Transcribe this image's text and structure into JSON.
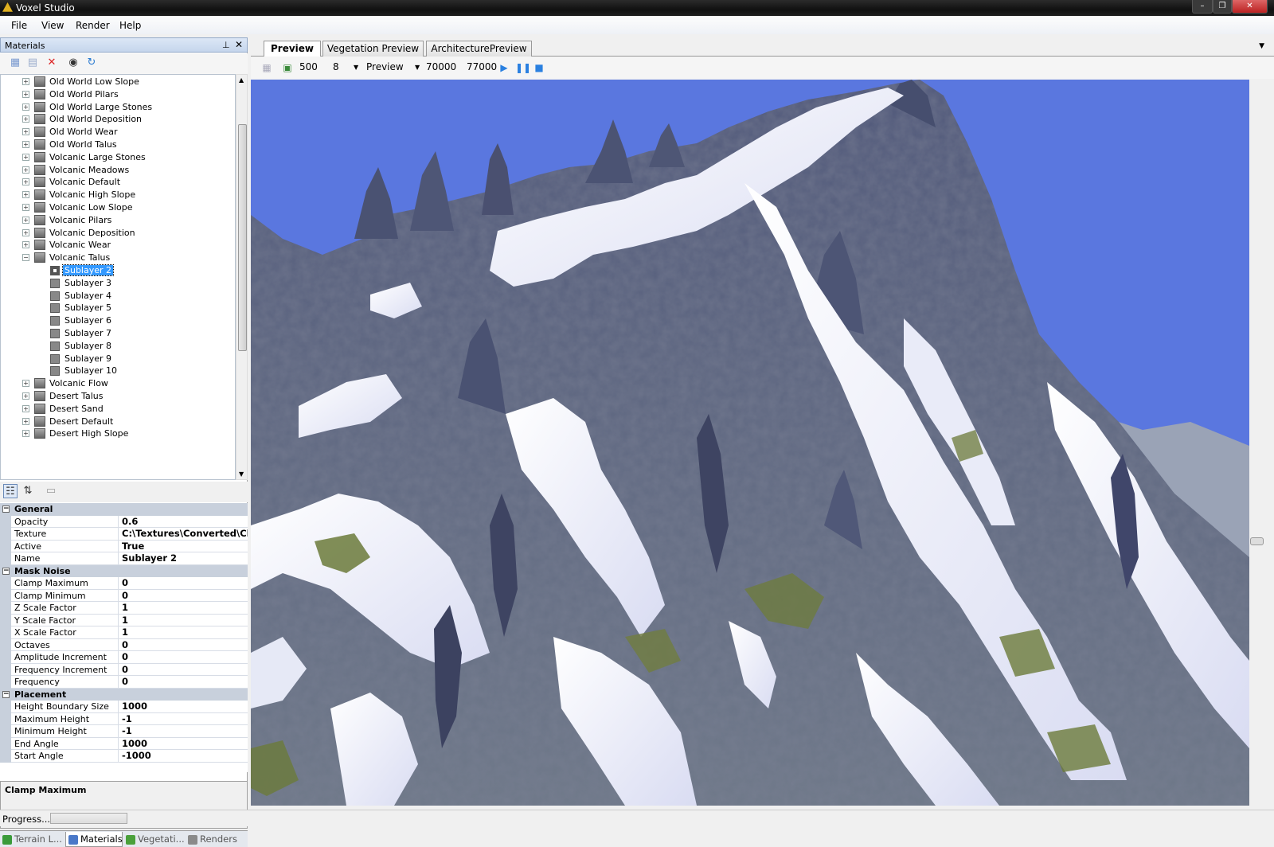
{
  "window": {
    "title": "Voxel Studio",
    "icon": "app-logo-icon"
  },
  "menu": [
    "File",
    "View",
    "Render",
    "Help"
  ],
  "materials_panel": {
    "title": "Materials",
    "toolbar_icons": [
      "new-material-icon",
      "new-folder-icon",
      "delete-icon",
      "preview-eye-icon",
      "refresh-icon"
    ],
    "tree": [
      {
        "label": "Old World Low Slope",
        "level": 0,
        "expanded": false
      },
      {
        "label": "Old World Pilars",
        "level": 0,
        "expanded": false
      },
      {
        "label": "Old World Large Stones",
        "level": 0,
        "expanded": false
      },
      {
        "label": "Old World Deposition",
        "level": 0,
        "expanded": false
      },
      {
        "label": "Old World Wear",
        "level": 0,
        "expanded": false
      },
      {
        "label": "Old World Talus",
        "level": 0,
        "expanded": false
      },
      {
        "label": "Volcanic Large Stones",
        "level": 0,
        "expanded": false
      },
      {
        "label": "Volcanic Meadows",
        "level": 0,
        "expanded": false
      },
      {
        "label": "Volcanic Default",
        "level": 0,
        "expanded": false
      },
      {
        "label": "Volcanic High Slope",
        "level": 0,
        "expanded": false
      },
      {
        "label": "Volcanic Low Slope",
        "level": 0,
        "expanded": false
      },
      {
        "label": "Volcanic Pilars",
        "level": 0,
        "expanded": false
      },
      {
        "label": "Volcanic Deposition",
        "level": 0,
        "expanded": false
      },
      {
        "label": "Volcanic Wear",
        "level": 0,
        "expanded": false
      },
      {
        "label": "Volcanic Talus",
        "level": 0,
        "expanded": true
      },
      {
        "label": "Sublayer 2",
        "level": 1,
        "selected": true
      },
      {
        "label": "Sublayer 3",
        "level": 1
      },
      {
        "label": "Sublayer 4",
        "level": 1
      },
      {
        "label": "Sublayer 5",
        "level": 1
      },
      {
        "label": "Sublayer 6",
        "level": 1
      },
      {
        "label": "Sublayer 7",
        "level": 1
      },
      {
        "label": "Sublayer 8",
        "level": 1
      },
      {
        "label": "Sublayer 9",
        "level": 1
      },
      {
        "label": "Sublayer 10",
        "level": 1
      },
      {
        "label": "Volcanic Flow",
        "level": 0,
        "expanded": false
      },
      {
        "label": "Desert Talus",
        "level": 0,
        "expanded": false
      },
      {
        "label": "Desert Sand",
        "level": 0,
        "expanded": false
      },
      {
        "label": "Desert Default",
        "level": 0,
        "expanded": false
      },
      {
        "label": "Desert High Slope",
        "level": 0,
        "expanded": false
      }
    ]
  },
  "properties": {
    "categories": [
      {
        "name": "General",
        "rows": [
          {
            "name": "Opacity",
            "value": "0.6"
          },
          {
            "name": "Texture",
            "value": "C:\\Textures\\Converted\\Cliff"
          },
          {
            "name": "Active",
            "value": "True"
          },
          {
            "name": "Name",
            "value": "Sublayer 2"
          }
        ]
      },
      {
        "name": "Mask Noise",
        "rows": [
          {
            "name": "Clamp Maximum",
            "value": "0"
          },
          {
            "name": "Clamp Minimum",
            "value": "0"
          },
          {
            "name": "Z Scale Factor",
            "value": "1"
          },
          {
            "name": "Y Scale Factor",
            "value": "1"
          },
          {
            "name": "X Scale Factor",
            "value": "1"
          },
          {
            "name": "Octaves",
            "value": "0"
          },
          {
            "name": "Amplitude Increment",
            "value": "0"
          },
          {
            "name": "Frequency Increment",
            "value": "0"
          },
          {
            "name": "Frequency",
            "value": "0"
          }
        ]
      },
      {
        "name": "Placement",
        "rows": [
          {
            "name": "Height Boundary Size",
            "value": "1000"
          },
          {
            "name": "Maximum Height",
            "value": "-1"
          },
          {
            "name": "Minimum Height",
            "value": "-1"
          },
          {
            "name": "End Angle",
            "value": "1000"
          },
          {
            "name": "Start Angle",
            "value": "-1000"
          }
        ]
      }
    ],
    "description_title": "Clamp Maximum"
  },
  "bottom_tabs": [
    {
      "label": "Terrain L...",
      "icon": "terrain-icon",
      "color": "#3a9a3a",
      "active": false
    },
    {
      "label": "Materials",
      "icon": "materials-icon",
      "color": "#4a78c8",
      "active": true
    },
    {
      "label": "Vegetati...",
      "icon": "tree-icon",
      "color": "#4aa03a",
      "active": false
    },
    {
      "label": "Renders",
      "icon": "renders-icon",
      "color": "#8a8a8a",
      "active": false
    }
  ],
  "doc_tabs": [
    {
      "label": "Preview",
      "active": true
    },
    {
      "label": "Vegetation Preview",
      "active": false
    },
    {
      "label": "ArchitecturePreview",
      "active": false
    }
  ],
  "preview_toolbar": {
    "size": "500",
    "lod": "8",
    "mode": "Preview",
    "value1": "70000",
    "value2": "77000"
  },
  "status": {
    "text": "Progress..."
  },
  "colors": {
    "sky": "#5a77df",
    "selection": "#3399ff",
    "snow": "#f4f4fb",
    "rock": "#6a7490",
    "moss": "#6b7a3a"
  }
}
